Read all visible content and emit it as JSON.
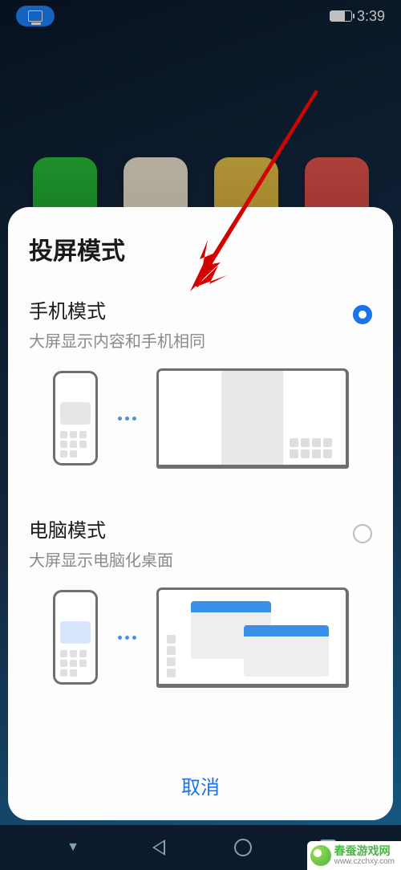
{
  "status": {
    "time": "3:39"
  },
  "sheet": {
    "title": "投屏模式",
    "options": {
      "phone": {
        "title": "手机模式",
        "subtitle": "大屏显示内容和手机相同",
        "selected": true
      },
      "pc": {
        "title": "电脑模式",
        "subtitle": "大屏显示电脑化桌面",
        "selected": false
      }
    },
    "cancel": "取消"
  },
  "watermark": {
    "cn": "春蚕游戏网",
    "en": "www.czchxy.com"
  }
}
